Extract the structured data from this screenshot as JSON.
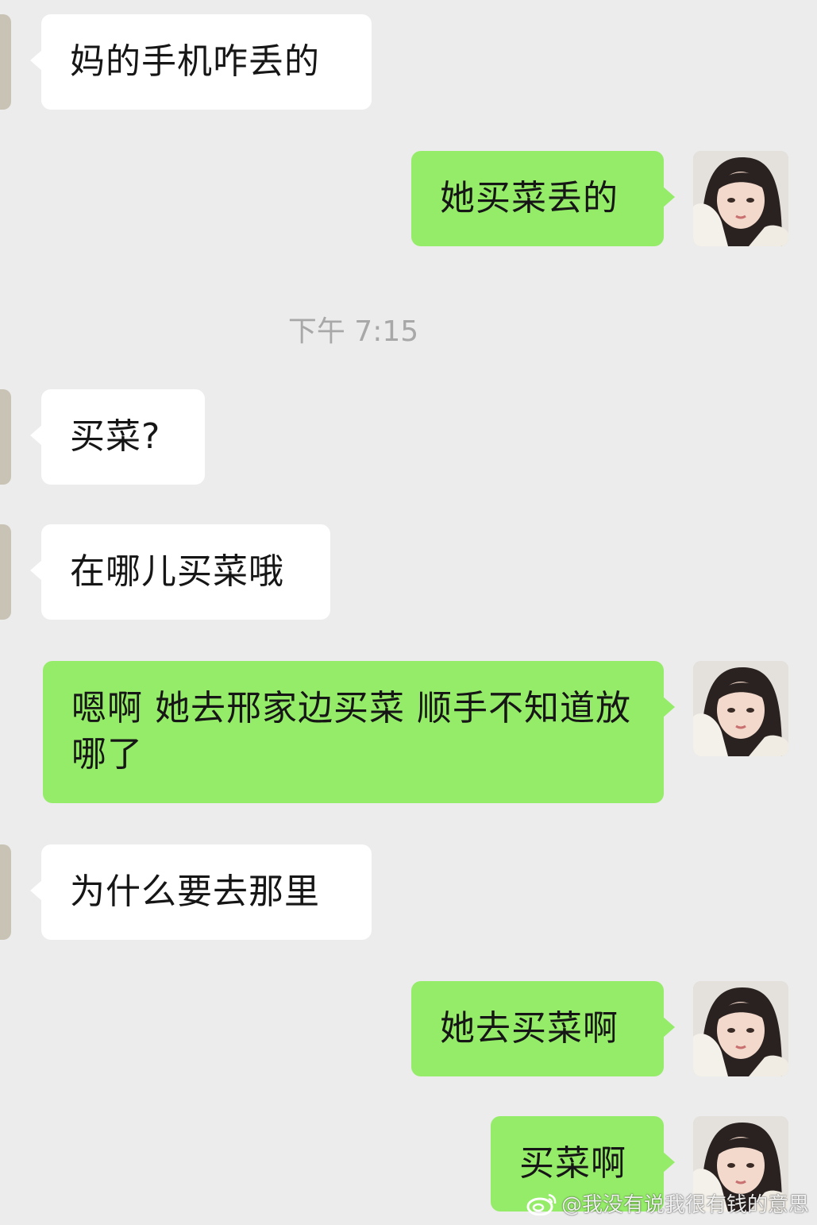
{
  "colors": {
    "background": "#ececec",
    "incoming_bubble": "#ffffff",
    "outgoing_bubble": "#95ec69",
    "timestamp_text": "#a8a8a8"
  },
  "messages": [
    {
      "side": "incoming",
      "text": "妈的手机咋丢的"
    },
    {
      "side": "outgoing",
      "text": "她买菜丢的"
    },
    {
      "side": "incoming",
      "text": "买菜?"
    },
    {
      "side": "incoming",
      "text": "在哪儿买菜哦"
    },
    {
      "side": "outgoing",
      "text": "嗯啊 她去邢家边买菜 顺手不知道放哪了"
    },
    {
      "side": "incoming",
      "text": "为什么要去那里"
    },
    {
      "side": "outgoing",
      "text": "她去买菜啊"
    },
    {
      "side": "outgoing",
      "text": "买菜啊"
    }
  ],
  "timestamp": "下午 7:15",
  "avatar_icon": "user-photo-avatar",
  "watermark": {
    "icon": "weibo-logo-icon",
    "text": "@我没有说我很有钱的意思"
  }
}
